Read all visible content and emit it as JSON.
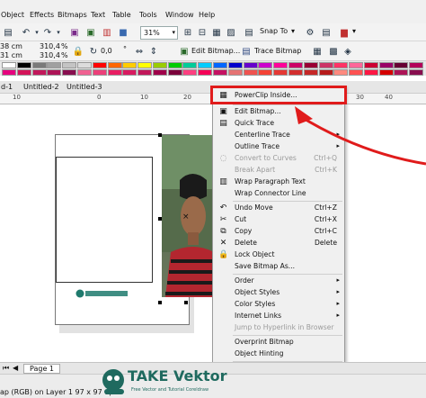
{
  "menubar": {
    "items": [
      "Object",
      "Effects",
      "Bitmaps",
      "Text",
      "Table",
      "Tools",
      "Window",
      "Help"
    ]
  },
  "toolbar": {
    "zoom": "31%",
    "snap_to": "Snap To"
  },
  "propbar": {
    "width": "38 cm",
    "height": "31 cm",
    "scale_x": "310,4",
    "scale_y": "310,4",
    "pct": "%",
    "rotation": "0,0",
    "rotation_unit": "°",
    "edit_bitmap": "Edit Bitmap...",
    "trace_bitmap": "Trace Bitmap"
  },
  "tabs": [
    "d-1",
    "Untitled-2",
    "Untitled-3"
  ],
  "ruler": [
    "10",
    "0",
    "10",
    "20",
    "30",
    "40"
  ],
  "page_logo": "TAKEVektor",
  "watermark": {
    "brand": "TAKE Vektor",
    "tagline": "Free Vector and Tutorial Coreldraw"
  },
  "context_menu": [
    {
      "label": "PowerClip Inside...",
      "shortcut": "",
      "sub": false,
      "disabled": false,
      "icon": "powerclip-icon"
    },
    {
      "sep": true
    },
    {
      "label": "Edit Bitmap...",
      "shortcut": "",
      "sub": false,
      "disabled": false,
      "icon": "edit-bitmap-icon"
    },
    {
      "label": "Quick Trace",
      "shortcut": "",
      "sub": false,
      "disabled": false,
      "icon": "quick-trace-icon"
    },
    {
      "label": "Centerline Trace",
      "shortcut": "",
      "sub": true,
      "disabled": false,
      "icon": ""
    },
    {
      "label": "Outline Trace",
      "shortcut": "",
      "sub": true,
      "disabled": false,
      "icon": ""
    },
    {
      "label": "Convert to Curves",
      "shortcut": "Ctrl+Q",
      "sub": false,
      "disabled": true,
      "icon": "convert-curves-icon"
    },
    {
      "label": "Break Apart",
      "shortcut": "Ctrl+K",
      "sub": false,
      "disabled": true,
      "icon": ""
    },
    {
      "label": "Wrap Paragraph Text",
      "shortcut": "",
      "sub": false,
      "disabled": false,
      "icon": "wrap-paragraph-icon"
    },
    {
      "label": "Wrap Connector Line",
      "shortcut": "",
      "sub": false,
      "disabled": false,
      "icon": ""
    },
    {
      "sep": true
    },
    {
      "label": "Undo Move",
      "shortcut": "Ctrl+Z",
      "sub": false,
      "disabled": false,
      "icon": "undo-icon"
    },
    {
      "label": "Cut",
      "shortcut": "Ctrl+X",
      "sub": false,
      "disabled": false,
      "icon": "cut-icon"
    },
    {
      "label": "Copy",
      "shortcut": "Ctrl+C",
      "sub": false,
      "disabled": false,
      "icon": "copy-icon"
    },
    {
      "label": "Delete",
      "shortcut": "Delete",
      "sub": false,
      "disabled": false,
      "icon": "delete-icon"
    },
    {
      "label": "Lock Object",
      "shortcut": "",
      "sub": false,
      "disabled": false,
      "icon": "lock-icon"
    },
    {
      "label": "Save Bitmap As...",
      "shortcut": "",
      "sub": false,
      "disabled": false,
      "icon": ""
    },
    {
      "sep": true
    },
    {
      "label": "Order",
      "shortcut": "",
      "sub": true,
      "disabled": false,
      "icon": ""
    },
    {
      "label": "Object Styles",
      "shortcut": "",
      "sub": true,
      "disabled": false,
      "icon": ""
    },
    {
      "label": "Color Styles",
      "shortcut": "",
      "sub": true,
      "disabled": false,
      "icon": ""
    },
    {
      "label": "Internet Links",
      "shortcut": "",
      "sub": true,
      "disabled": false,
      "icon": ""
    },
    {
      "label": "Jump to Hyperlink in Browser",
      "shortcut": "",
      "sub": false,
      "disabled": true,
      "icon": ""
    },
    {
      "sep": true
    },
    {
      "label": "Overprint Bitmap",
      "shortcut": "",
      "sub": false,
      "disabled": false,
      "icon": ""
    },
    {
      "label": "Object Hinting",
      "shortcut": "",
      "sub": false,
      "disabled": false,
      "icon": ""
    },
    {
      "sep": true
    },
    {
      "label": "Object Properties",
      "shortcut": "Alt+Enter",
      "sub": false,
      "disabled": false,
      "icon": ""
    },
    {
      "label": "Symbol",
      "shortcut": "",
      "sub": true,
      "disabled": false,
      "icon": ""
    }
  ],
  "status": {
    "page_tab": "Page 1",
    "info": "ap (RGB) on Layer 1 97 x 97 dpi"
  },
  "palette_colors": [
    "#ffffff",
    "#000000",
    "#7a7a7a",
    "#a0a0a0",
    "#c4c4c4",
    "#dcdcdc",
    "#ff0000",
    "#ff6600",
    "#ffcc00",
    "#ffff00",
    "#99cc00",
    "#00cc00",
    "#00cc99",
    "#00ccff",
    "#0066ff",
    "#0000cc",
    "#6600cc",
    "#cc00cc",
    "#ff0099",
    "#cc0066",
    "#990033",
    "#cc3366",
    "#ff3366",
    "#ff6699",
    "#cc0033",
    "#990066",
    "#660033",
    "#b3005a",
    "#e6007e",
    "#d4145a",
    "#c2185b",
    "#ad1457",
    "#880e4f",
    "#f06292",
    "#ec407a",
    "#e91e63",
    "#d81b60",
    "#c2185b",
    "#a0004a",
    "#7a003a",
    "#ff4081",
    "#f50057",
    "#c51162",
    "#e57373",
    "#ef5350",
    "#f44336",
    "#e53935",
    "#d32f2f",
    "#c62828",
    "#b71c1c",
    "#ff8a80",
    "#ff5252",
    "#ff1744",
    "#d50000",
    "#ad1457",
    "#880e4f"
  ],
  "accent": "#e01b1b"
}
